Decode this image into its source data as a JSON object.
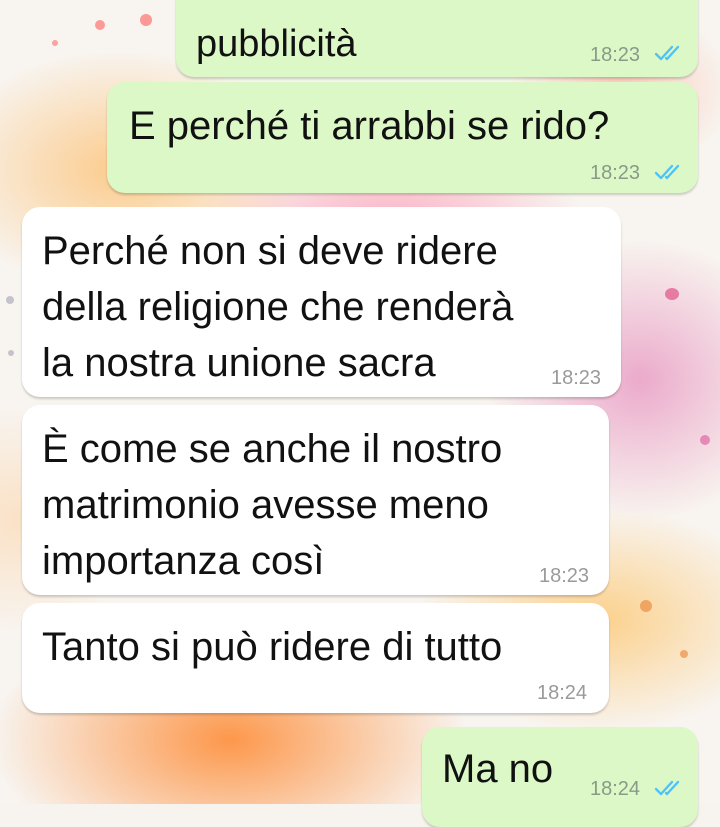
{
  "messages": [
    {
      "direction": "outgoing",
      "text": "pubblicità",
      "time": "18:23",
      "status": "read"
    },
    {
      "direction": "outgoing",
      "text": "E perché ti arrabbi se rido?",
      "time": "18:23",
      "status": "read"
    },
    {
      "direction": "incoming",
      "lines": [
        "Perché non si deve ridere",
        "della religione che renderà",
        "la nostra unione sacra"
      ],
      "time": "18:23"
    },
    {
      "direction": "incoming",
      "lines": [
        "È come se anche il nostro",
        "matrimonio avesse meno",
        "importanza così"
      ],
      "time": "18:23"
    },
    {
      "direction": "incoming",
      "text": "Tanto si può ridere di tutto",
      "time": "18:24"
    },
    {
      "direction": "outgoing",
      "text": "Ma no",
      "time": "18:24",
      "status": "read"
    }
  ],
  "colors": {
    "outgoing_bubble": "#dcf8c6",
    "incoming_bubble": "#ffffff",
    "read_ticks": "#4fc3f7"
  },
  "icons": {
    "read_receipt": "double-check-icon"
  }
}
